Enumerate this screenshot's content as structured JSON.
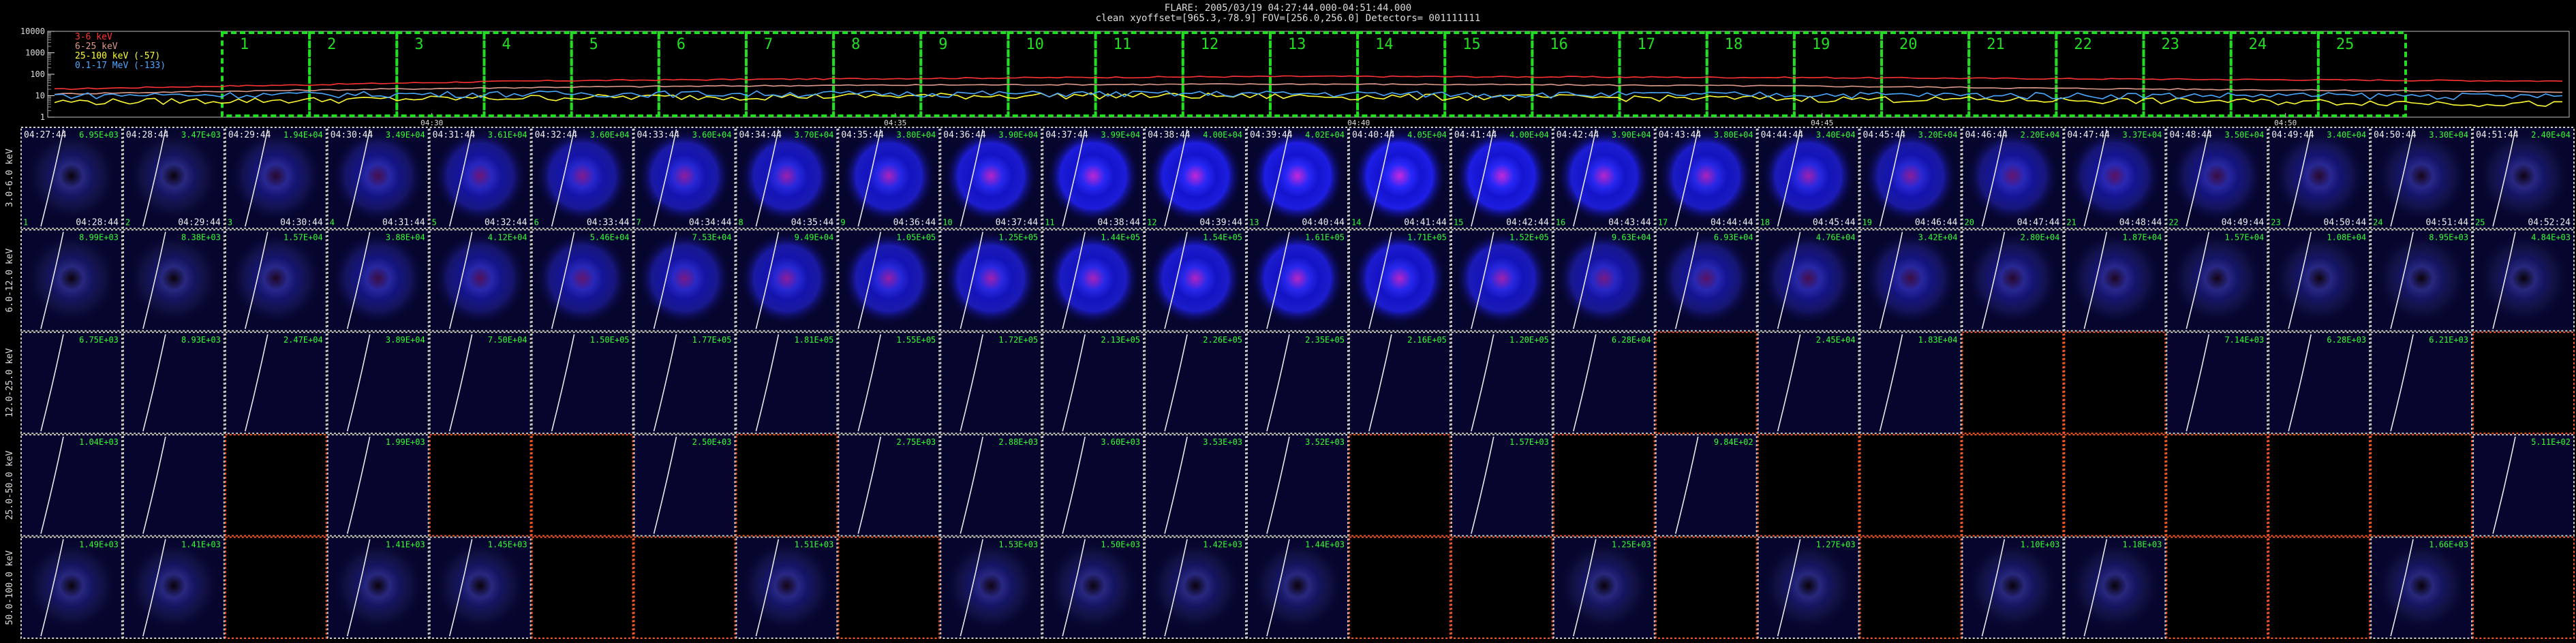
{
  "header": {
    "line1": "FLARE: 2005/03/19 04:27:44.000-04:51:44.000",
    "line2": "clean   xyoffset=[965.3,-78.9]   FOV=[256.0,256.0]   Detectors= 001111111"
  },
  "colors": {
    "grid_ok": "#cfcfcf",
    "grid_bad": "#ff5a2a",
    "interval_box": "#22dd22",
    "label_green": "#33ff33",
    "band_3_6": "#ff3333",
    "band_6_25": "#dd9a8a",
    "band_25_100": "#ffff33",
    "band_100k": "#4aa8ff"
  },
  "chart_data": [
    {
      "type": "line",
      "title": "",
      "yscale": "log",
      "ylim": [
        1,
        10000
      ],
      "yticks": [
        "10000",
        "1000",
        "100",
        "10",
        "1"
      ],
      "xticks": [
        "04:30",
        "04:35",
        "04:40",
        "04:45",
        "04:50"
      ],
      "time_range": [
        "04:27:44",
        "04:51:44"
      ],
      "grid": false,
      "legend_position": "top-left",
      "legend": [
        "3-6 keV",
        "6-25 keV",
        "25-100 keV (-57)",
        "0.1-17 MeV (-133)"
      ],
      "series": [
        {
          "name": "3-6 keV",
          "color_key": "band_3_6",
          "x_minutes": [
            0,
            3,
            6,
            9,
            12,
            15,
            18,
            21,
            24,
            27,
            30
          ],
          "values": [
            20,
            32,
            50,
            60,
            70,
            80,
            75,
            70,
            62,
            55,
            48
          ]
        },
        {
          "name": "6-25 keV",
          "color_key": "band_6_25",
          "x_minutes": [
            0,
            3,
            6,
            9,
            12,
            15,
            18,
            21,
            24,
            27,
            30
          ],
          "values": [
            12,
            18,
            25,
            30,
            33,
            35,
            32,
            28,
            22,
            18,
            15
          ]
        },
        {
          "name": "25-100 keV (-57)",
          "color_key": "band_25_100",
          "x_minutes": [
            0,
            3,
            6,
            9,
            12,
            15,
            18,
            21,
            24,
            27,
            30
          ],
          "values": [
            5,
            6,
            8,
            9,
            10,
            9,
            8,
            7,
            6,
            5,
            4
          ]
        },
        {
          "name": "0.1-17 MeV (-133)",
          "color_key": "band_100k",
          "x_minutes": [
            0,
            3,
            6,
            9,
            12,
            15,
            18,
            21,
            24,
            27,
            30
          ],
          "values": [
            10,
            11,
            12,
            12,
            12,
            12,
            11,
            11,
            10,
            10,
            9
          ]
        }
      ],
      "intervals": [
        "1",
        "2",
        "3",
        "4",
        "5",
        "6",
        "7",
        "8",
        "9",
        "10",
        "11",
        "12",
        "13",
        "14",
        "15",
        "16",
        "17",
        "18",
        "19",
        "20",
        "21",
        "22",
        "23",
        "24",
        "25"
      ]
    },
    {
      "type": "heatmap",
      "columns": 25,
      "start_times": [
        "04:27:44",
        "04:28:44",
        "04:29:44",
        "04:30:44",
        "04:31:44",
        "04:32:44",
        "04:33:44",
        "04:34:44",
        "04:35:44",
        "04:36:44",
        "04:37:44",
        "04:38:44",
        "04:39:44",
        "04:40:44",
        "04:41:44",
        "04:42:44",
        "04:43:44",
        "04:44:44",
        "04:45:44",
        "04:46:44",
        "04:47:44",
        "04:48:44",
        "04:49:44",
        "04:50:44",
        "04:51:44"
      ],
      "end_times": [
        "04:28:44",
        "04:29:44",
        "04:30:44",
        "04:31:44",
        "04:32:44",
        "04:33:44",
        "04:34:44",
        "04:35:44",
        "04:36:44",
        "04:37:44",
        "04:38:44",
        "04:39:44",
        "04:40:44",
        "04:41:44",
        "04:42:44",
        "04:43:44",
        "04:44:44",
        "04:45:44",
        "04:46:44",
        "04:47:44",
        "04:48:44",
        "04:49:44",
        "04:50:44",
        "04:51:44",
        "04:52:24"
      ],
      "rows": [
        {
          "band": "3.0-6.0 keV",
          "max": [
            "6.95E+03",
            "3.47E+03",
            "1.94E+04",
            "3.49E+04",
            "3.61E+04",
            "3.60E+04",
            "3.60E+04",
            "3.70E+04",
            "3.80E+04",
            "3.90E+04",
            "3.99E+04",
            "4.00E+04",
            "4.02E+04",
            "4.05E+04",
            "4.00E+04",
            "3.90E+04",
            "3.80E+04",
            "3.40E+04",
            "3.20E+04",
            "2.20E+04",
            "3.37E+04",
            "3.50E+04",
            "3.40E+04",
            "3.30E+04",
            "2.40E+04"
          ],
          "intensity": [
            0.05,
            0.05,
            0.2,
            0.35,
            0.55,
            0.65,
            0.72,
            0.78,
            0.85,
            0.9,
            0.95,
            0.97,
            0.98,
            1.0,
            0.98,
            0.92,
            0.85,
            0.8,
            0.7,
            0.5,
            0.45,
            0.3,
            0.2,
            0.12,
            0.08
          ],
          "bad": [
            0,
            0,
            0,
            0,
            0,
            0,
            0,
            0,
            0,
            0,
            0,
            0,
            0,
            0,
            0,
            0,
            0,
            0,
            0,
            0,
            0,
            0,
            0,
            0,
            0
          ]
        },
        {
          "band": "6.0-12.0 keV",
          "max": [
            "8.99E+03",
            "8.38E+03",
            "1.57E+04",
            "3.88E+04",
            "4.12E+04",
            "5.46E+04",
            "7.53E+04",
            "9.49E+04",
            "1.05E+05",
            "1.25E+05",
            "1.44E+05",
            "1.54E+05",
            "1.61E+05",
            "1.71E+05",
            "1.52E+05",
            "9.63E+04",
            "6.93E+04",
            "4.76E+04",
            "3.42E+04",
            "2.80E+04",
            "1.87E+04",
            "1.57E+04",
            "1.08E+04",
            "8.95E+03",
            "4.84E+03"
          ],
          "intensity": [
            0.05,
            0.05,
            0.15,
            0.3,
            0.4,
            0.5,
            0.6,
            0.7,
            0.75,
            0.8,
            0.85,
            0.88,
            0.9,
            0.9,
            0.8,
            0.6,
            0.45,
            0.35,
            0.3,
            0.2,
            0.15,
            0.1,
            0.08,
            0.05,
            0.04
          ],
          "bad": [
            0,
            0,
            0,
            0,
            0,
            0,
            0,
            0,
            0,
            0,
            0,
            0,
            0,
            0,
            0,
            0,
            0,
            0,
            0,
            0,
            0,
            0,
            0,
            0,
            0
          ]
        },
        {
          "band": "12.0-25.0 keV",
          "max": [
            "6.75E+03",
            "8.93E+03",
            "2.47E+04",
            "3.89E+04",
            "7.50E+04",
            "1.50E+05",
            "1.77E+05",
            "1.81E+05",
            "1.55E+05",
            "1.72E+05",
            "2.13E+05",
            "2.26E+05",
            "2.35E+05",
            "2.16E+05",
            "1.20E+05",
            "6.28E+04",
            "",
            "2.45E+04",
            "1.83E+04",
            "",
            "",
            "7.14E+03",
            "6.28E+03",
            "6.21E+03",
            ""
          ],
          "intensity": [
            0,
            0,
            0,
            0,
            0,
            0,
            0,
            0,
            0,
            0,
            0,
            0,
            0,
            0,
            0,
            0,
            0,
            0,
            0,
            0,
            0,
            0,
            0,
            0,
            0
          ],
          "bad": [
            0,
            0,
            0,
            0,
            0,
            0,
            0,
            0,
            0,
            0,
            0,
            0,
            0,
            0,
            0,
            0,
            1,
            0,
            0,
            1,
            1,
            0,
            0,
            0,
            1
          ]
        },
        {
          "band": "25.0-50.0 keV",
          "max": [
            "1.04E+03",
            "",
            "",
            "1.99E+03",
            "",
            "",
            "2.50E+03",
            "",
            "2.75E+03",
            "2.88E+03",
            "3.60E+03",
            "3.53E+03",
            "3.52E+03",
            "",
            "1.57E+03",
            "",
            "9.84E+02",
            "",
            "",
            "",
            "",
            "",
            "",
            "",
            "5.11E+02"
          ],
          "intensity": [
            0,
            0,
            0,
            0,
            0,
            0,
            0,
            0,
            0,
            0,
            0,
            0,
            0,
            0,
            0,
            0,
            0,
            0,
            0,
            0,
            0,
            0,
            0,
            0,
            0
          ],
          "bad": [
            0,
            0,
            1,
            0,
            1,
            1,
            0,
            1,
            0,
            0,
            0,
            0,
            0,
            1,
            0,
            1,
            0,
            1,
            1,
            1,
            1,
            1,
            1,
            1,
            0
          ]
        },
        {
          "band": "50.0-100.0 keV",
          "max": [
            "1.49E+03",
            "1.41E+03",
            "",
            "1.41E+03",
            "1.45E+03",
            "",
            "",
            "1.51E+03",
            "",
            "1.53E+03",
            "1.50E+03",
            "1.42E+03",
            "1.44E+03",
            "",
            "",
            "1.25E+03",
            "",
            "1.27E+03",
            "",
            "1.10E+03",
            "1.18E+03",
            "",
            "",
            "1.66E+03",
            ""
          ],
          "intensity": [
            0.05,
            0.05,
            0,
            0.05,
            0.05,
            0,
            0,
            0.1,
            0,
            0.08,
            0.06,
            0.05,
            0.05,
            0,
            0,
            0.04,
            0,
            0.04,
            0,
            0.04,
            0.04,
            0,
            0,
            0.04,
            0
          ],
          "bad": [
            0,
            0,
            1,
            0,
            0,
            1,
            1,
            0,
            1,
            0,
            0,
            0,
            0,
            1,
            1,
            0,
            1,
            0,
            1,
            0,
            0,
            1,
            1,
            0,
            1
          ]
        }
      ]
    }
  ]
}
